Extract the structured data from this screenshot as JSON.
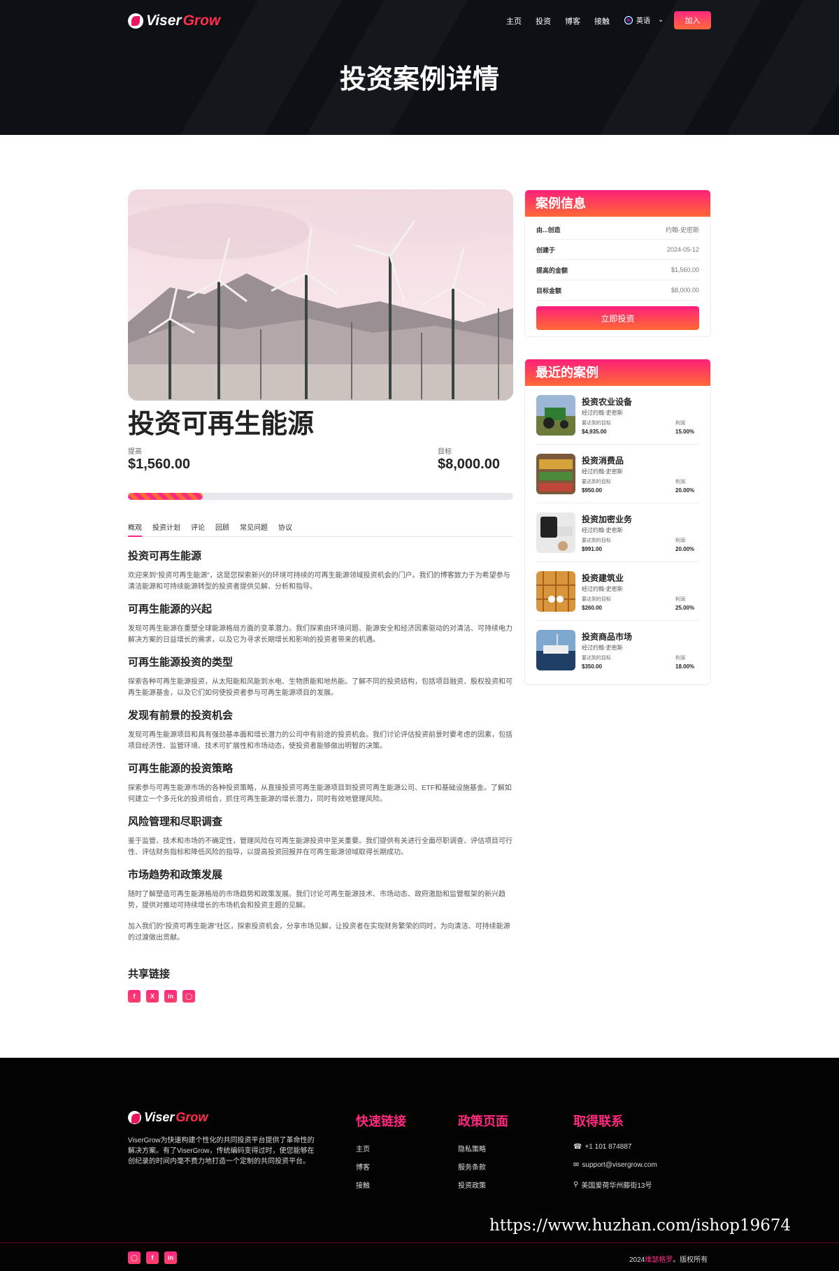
{
  "header": {
    "logo_part1": "Viser",
    "logo_part2": "Grow",
    "nav": [
      "主页",
      "投资",
      "博客",
      "接触"
    ],
    "language": "英语",
    "join_label": "加入",
    "page_title": "投资案例详情"
  },
  "case": {
    "title": "投资可再生能源",
    "raised_label": "提高",
    "raised_value": "$1,560.00",
    "goal_label": "目标",
    "goal_value": "$8,000.00",
    "progress_percent": 19.5,
    "tabs": [
      "概观",
      "投资计划",
      "评论",
      "回顾",
      "常见问题",
      "协议"
    ],
    "active_tab": 0,
    "sections": [
      {
        "heading": "投资可再生能源",
        "text": "欢迎来到“投资可再生能源”，这是您探索新兴的环境可持续的可再生能源领域投资机会的门户。我们的博客致力于为希望参与清洁能源和可持续能源转型的投资者提供见解、分析和指导。"
      },
      {
        "heading": "可再生能源的兴起",
        "text": "发现可再生能源在重塑全球能源格局方面的变革潜力。我们探索由环境问题、能源安全和经济因素驱动的对清洁、可持续电力解决方案的日益增长的需求，以及它为寻求长期增长和影响的投资者带来的机遇。"
      },
      {
        "heading": "可再生能源投资的类型",
        "text": "探索各种可再生能源投资，从太阳能和风能到水电、生物质能和地热能。了解不同的投资结构，包括项目融资、股权投资和可再生能源基金，以及它们如何使投资者参与可再生能源项目的发展。"
      },
      {
        "heading": "发现有前景的投资机会",
        "text": "发现可再生能源项目和具有强劲基本面和增长潜力的公司中有前途的投资机会。我们讨论评估投资前景时要考虑的因素，包括项目经济性、监管环境、技术可扩展性和市场动态，使投资者能够做出明智的决策。"
      },
      {
        "heading": "可再生能源的投资策略",
        "text": "探索参与可再生能源市场的各种投资策略，从直接投资可再生能源项目到投资可再生能源公司、ETF和基础设施基金。了解如何建立一个多元化的投资组合，抓住可再生能源的增长潜力，同时有效地管理风险。"
      },
      {
        "heading": "风险管理和尽职调查",
        "text": "鉴于监管、技术和市场的不确定性，管理风险在可再生能源投资中至关重要。我们提供有关进行全面尽职调查、评估项目可行性、评估财务指标和降低风险的指导，以提高投资回报并在可再生能源领域取得长期成功。"
      },
      {
        "heading": "市场趋势和政策发展",
        "text": "随时了解塑造可再生能源格局的市场趋势和政策发展。我们讨论可再生能源技术、市场动态、政府激励和监管框架的新兴趋势，提供对推动可持续增长的市场机会和投资主题的见解。"
      }
    ],
    "closing": "加入我们的“投资可再生能源”社区，探索投资机会，分享市场见解，让投资者在实现财务繁荣的同时，为向清洁、可持续能源的过渡做出贡献。",
    "share_title": "共享链接",
    "share_icons": [
      "f",
      "X",
      "in",
      "ig"
    ]
  },
  "info_card": {
    "title": "案例信息",
    "rows": [
      {
        "k": "由...创造",
        "v": "约翰·史密斯"
      },
      {
        "k": "创建于",
        "v": "2024-05-12"
      },
      {
        "k": "提高的金额",
        "v": "$1,560.00"
      },
      {
        "k": "目标金额",
        "v": "$8,000.00"
      }
    ],
    "button": "立即投资"
  },
  "recent_card": {
    "title": "最近的案例",
    "goal_label": "要达到的目标",
    "profit_label": "利润",
    "items": [
      {
        "title": "投资农业设备",
        "by": "经过约翰·史密斯",
        "goal": "$4,935.00",
        "profit": "15.00%"
      },
      {
        "title": "投资消费品",
        "by": "经过约翰·史密斯",
        "goal": "$950.00",
        "profit": "20.00%"
      },
      {
        "title": "投资加密业务",
        "by": "经过约翰·史密斯",
        "goal": "$991.00",
        "profit": "20.00%"
      },
      {
        "title": "投资建筑业",
        "by": "经过约翰·史密斯",
        "goal": "$260.00",
        "profit": "25.00%"
      },
      {
        "title": "投资商品市场",
        "by": "经过约翰·史密斯",
        "goal": "$350.00",
        "profit": "18.00%"
      }
    ]
  },
  "footer": {
    "about": "ViserGrow为快速构建个性化的共同投资平台提供了革命性的解决方案。有了ViserGrow，传统编码变得过时，使您能够在创纪录的时间内毫不费力地打造一个定制的共同投资平台。",
    "quick_title": "快速链接",
    "quick_links": [
      "主页",
      "博客",
      "接触"
    ],
    "policy_title": "政策页面",
    "policy_links": [
      "隐私策略",
      "服务条款",
      "投资政策"
    ],
    "contact_title": "取得联系",
    "phone": "+1 101 874887",
    "email": "support@visergrow.com",
    "address": "美国爱荷华州藤街13号",
    "social": [
      "ig",
      "f",
      "in"
    ],
    "copyright_year": "2024",
    "copyright_brand": "维瑟格罗",
    "copyright_tail": "。版权所有",
    "watermark": "https://www.huzhan.com/ishop19674"
  },
  "colors": {
    "accent": "#ff2a80",
    "accent2": "#ff6a35",
    "dark": "#0d1015"
  }
}
